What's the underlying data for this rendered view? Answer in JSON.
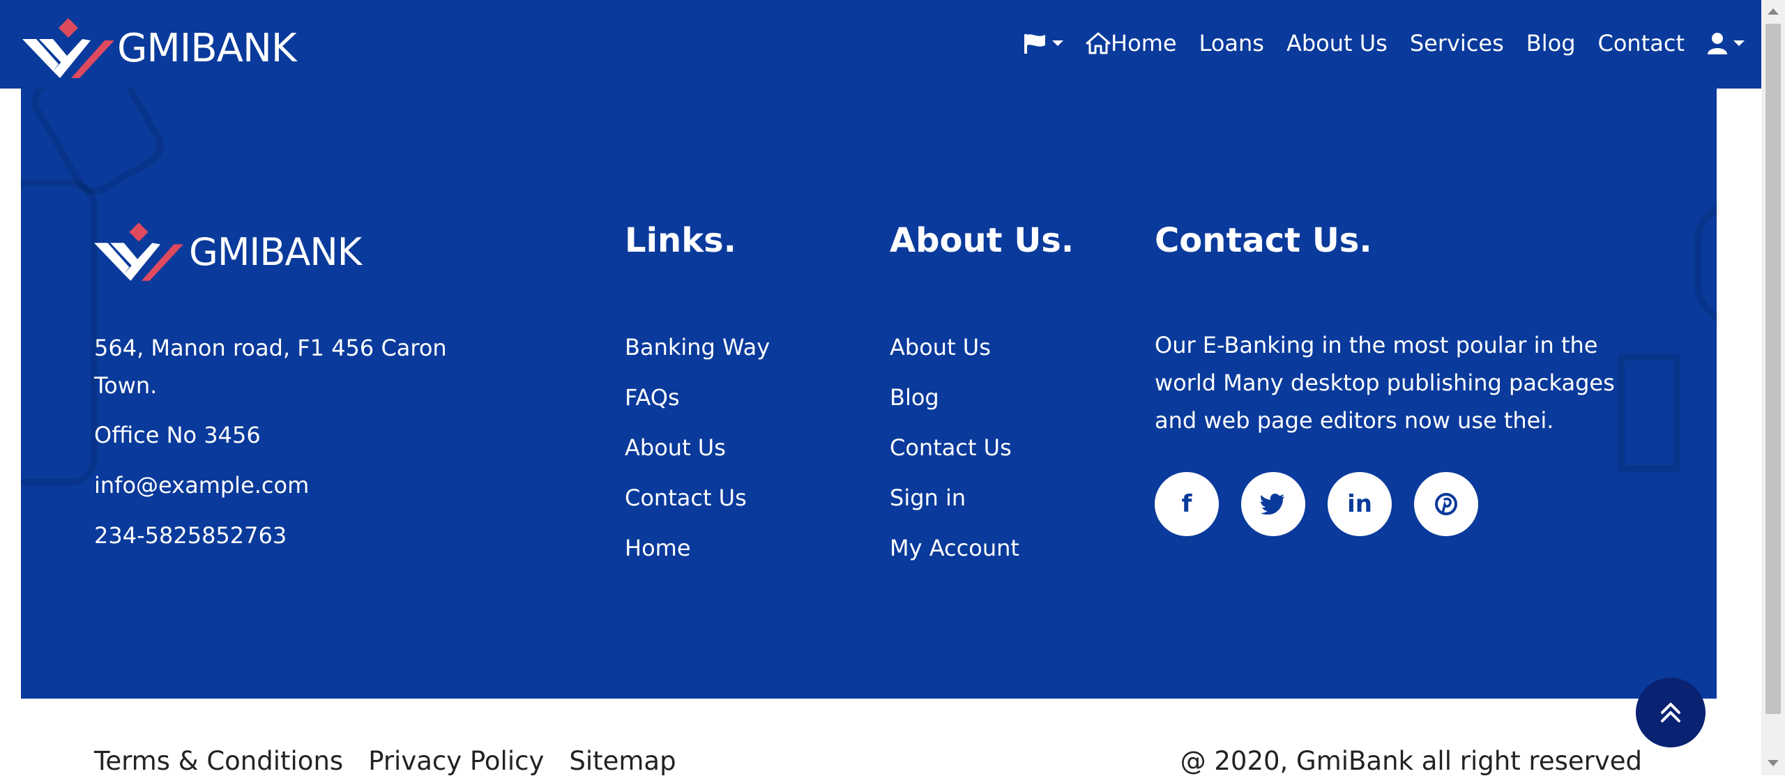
{
  "brand": {
    "name": "GMIBANK",
    "colors": {
      "primary": "#0a3a9b",
      "accent": "#e04a5f",
      "white": "#ffffff"
    }
  },
  "nav": {
    "language_icon": "flag-icon",
    "home_icon": "home-icon",
    "items": [
      "Home",
      "Loans",
      "About Us",
      "Services",
      "Blog",
      "Contact"
    ],
    "account_icon": "user-icon"
  },
  "footer": {
    "address": "564, Manon road, F1 456 Caron Town.",
    "office": "Office No 3456",
    "email": "info@example.com",
    "phone": "234-5825852763",
    "links_title": "Links.",
    "links": [
      "Banking Way",
      "FAQs",
      "About Us",
      "Contact Us",
      "Home"
    ],
    "about_title": "About Us.",
    "about_links": [
      "About Us",
      "Blog",
      "Contact Us",
      "Sign in",
      "My Account"
    ],
    "contact_title": "Contact Us.",
    "contact_text": "Our E-Banking in the most poular in the world Many desktop publishing packages and web page editors now use thei.",
    "social": [
      {
        "icon": "facebook-icon",
        "glyph": "f"
      },
      {
        "icon": "twitter-icon",
        "glyph": "t"
      },
      {
        "icon": "linkedin-icon",
        "glyph": "in"
      },
      {
        "icon": "pinterest-icon",
        "glyph": "p"
      }
    ]
  },
  "bottom": {
    "links": [
      "Terms & Conditions",
      "Privacy Policy",
      "Sitemap"
    ],
    "copyright": "@ 2020, GmiBank all right reserved"
  }
}
